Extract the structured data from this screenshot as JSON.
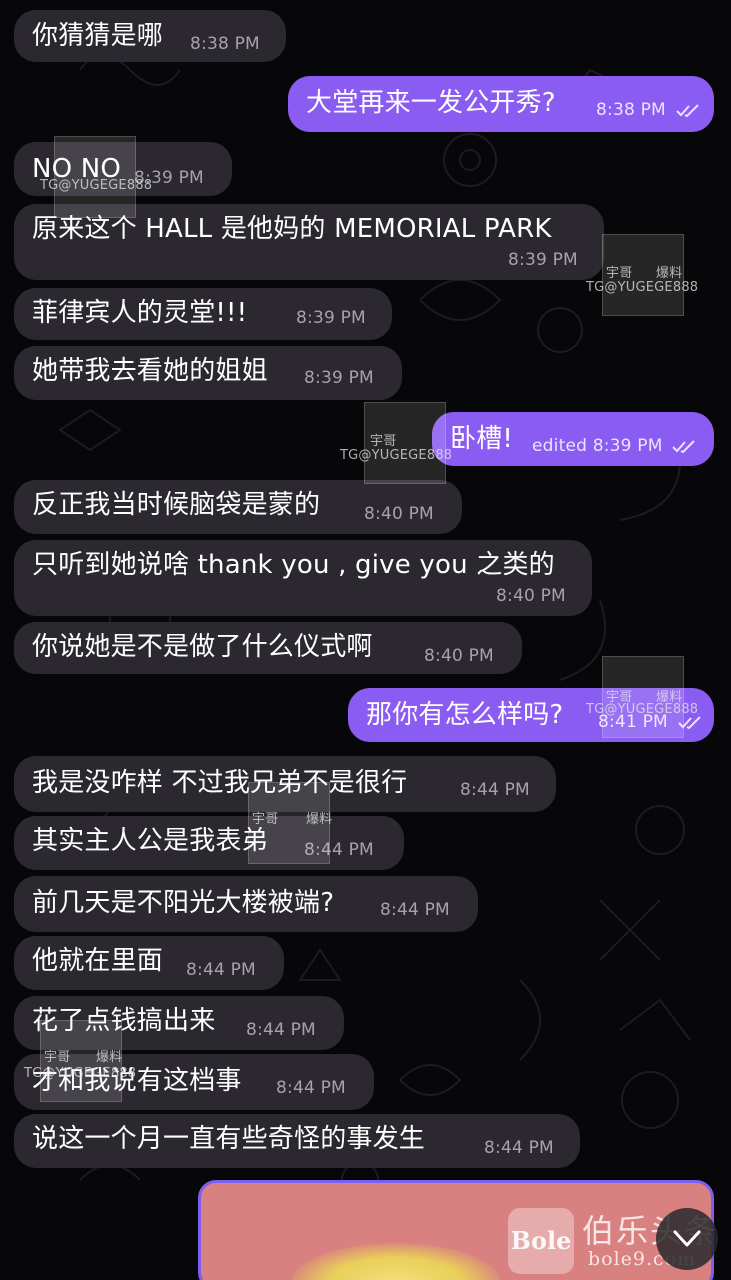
{
  "chat": {
    "messages": [
      {
        "direction": "in",
        "text": "你猜猜是哪",
        "time": "8:38 PM"
      },
      {
        "direction": "out",
        "text": "大堂再来一发公开秀?",
        "time": "8:38 PM",
        "status": "read"
      },
      {
        "direction": "in",
        "text": "NO NO",
        "time": "8:39 PM"
      },
      {
        "direction": "in",
        "text": "原来这个 HALL 是他妈的 MEMORIAL PARK",
        "time": "8:39 PM"
      },
      {
        "direction": "in",
        "text": "菲律宾人的灵堂!!!",
        "time": "8:39 PM"
      },
      {
        "direction": "in",
        "text": "她带我去看她的姐姐",
        "time": "8:39 PM"
      },
      {
        "direction": "out",
        "text": "卧槽!",
        "time": "edited 8:39 PM",
        "status": "read"
      },
      {
        "direction": "in",
        "text": "反正我当时候脑袋是蒙的",
        "time": "8:40 PM"
      },
      {
        "direction": "in",
        "text": "只听到她说啥 thank you , give you 之类的",
        "time": "8:40 PM"
      },
      {
        "direction": "in",
        "text": "你说她是不是做了什么仪式啊",
        "time": "8:40 PM"
      },
      {
        "direction": "out",
        "text": "那你有怎么样吗?",
        "time": "8:41 PM",
        "status": "read"
      },
      {
        "direction": "in",
        "text": "我是没咋样 不过我兄弟不是很行",
        "time": "8:44 PM"
      },
      {
        "direction": "in",
        "text": "其实主人公是我表弟",
        "time": "8:44 PM"
      },
      {
        "direction": "in",
        "text": "前几天是不阳光大楼被端?",
        "time": "8:44 PM"
      },
      {
        "direction": "in",
        "text": "他就在里面",
        "time": "8:44 PM"
      },
      {
        "direction": "in",
        "text": "花了点钱搞出来",
        "time": "8:44 PM"
      },
      {
        "direction": "in",
        "text": "才和我说有这档事",
        "time": "8:44 PM"
      },
      {
        "direction": "in",
        "text": "说这一个月一直有些奇怪的事发生",
        "time": "8:44 PM"
      }
    ]
  },
  "watermarks": {
    "label": "TG@YUGEGE888",
    "small_left": "宇哥",
    "small_right": "爆料"
  },
  "overlay_logo": {
    "mark": "Bole",
    "name": "伯乐头条",
    "url": "bole9.com"
  },
  "colors": {
    "outgoing_bubble": "#8a5cf2",
    "incoming_bubble": "#2b2830",
    "background": "#070608"
  },
  "icons": {
    "read_status": "double-check-icon",
    "scroll_down": "chevron-down-icon"
  }
}
